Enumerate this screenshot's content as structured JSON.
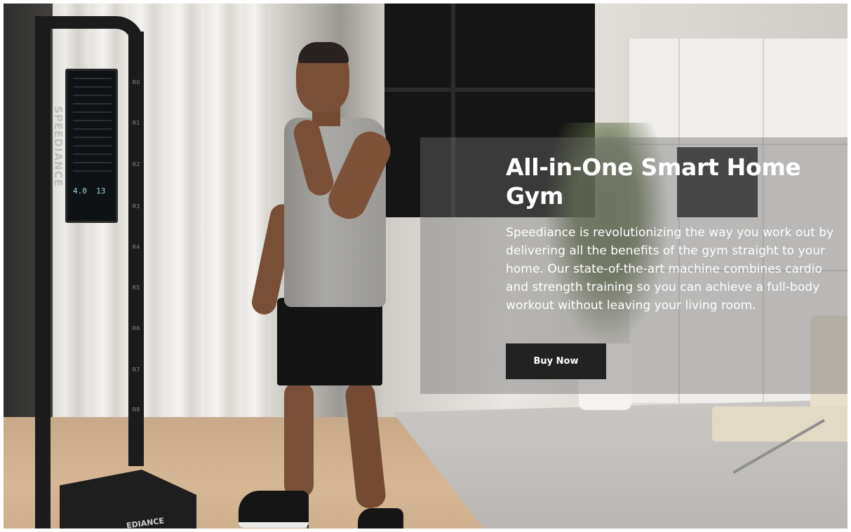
{
  "hero": {
    "title": "All-in-One Smart Home Gym",
    "description": "Speediance is revolutionizing the way you work out by delivering all the benefits of the gym straight to your home. Our state-of-the-art machine combines cardio and strength training so you can achieve a full-body workout without leaving your living room.",
    "cta_label": "Buy Now"
  },
  "photo": {
    "machine_brand": "SPEEDIANCE",
    "base_brand": "EDIANCE",
    "screen_values": [
      "4.0",
      "13"
    ],
    "rail_marks": [
      "R0",
      "R1",
      "R2",
      "R3",
      "R4",
      "R5",
      "R6",
      "R7",
      "R8"
    ]
  },
  "colors": {
    "button_bg": "#222222",
    "panel_overlay": "rgba(110,110,110,0.42)",
    "text": "#ffffff"
  }
}
